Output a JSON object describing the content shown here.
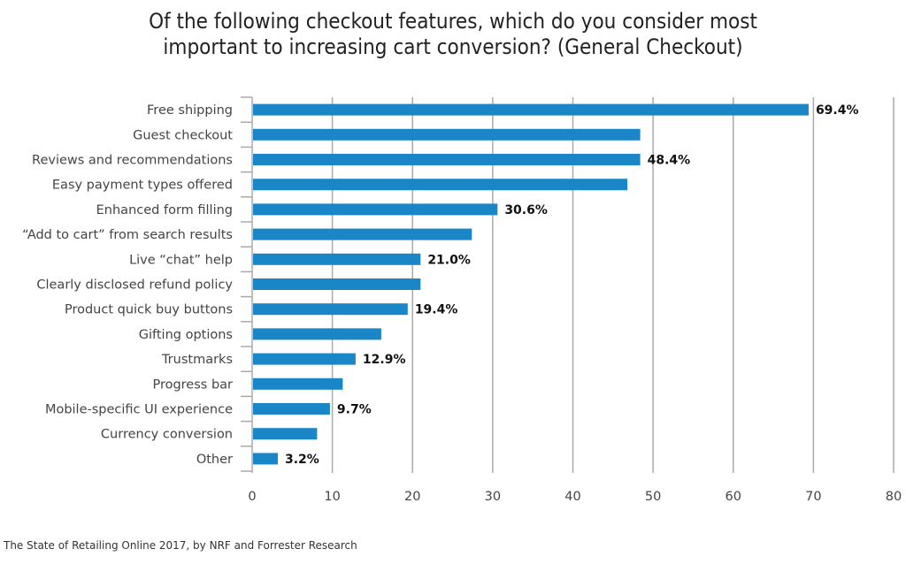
{
  "chart_data": {
    "type": "bar",
    "orientation": "horizontal",
    "title": "Of the following checkout features, which do you consider most important to increasing cart conversion? (General Checkout)",
    "title_lines": [
      "Of the following checkout features, which do you consider most",
      "important to increasing cart conversion? (General Checkout)"
    ],
    "xlabel": "",
    "ylabel": "",
    "xlim": [
      0,
      80
    ],
    "xticks": [
      0,
      10,
      20,
      30,
      40,
      50,
      60,
      70,
      80
    ],
    "grid": true,
    "bar_color": "#1a86c8",
    "categories": [
      "Free shipping",
      "Guest checkout",
      "Reviews and recommendations",
      "Easy payment types offered",
      "Enhanced form filling",
      "“Add to cart” from search results",
      "Live “chat” help",
      "Clearly disclosed refund policy",
      "Product quick buy buttons",
      "Gifting options",
      "Trustmarks",
      "Progress bar",
      "Mobile-specific UI experience",
      "Currency conversion",
      "Other"
    ],
    "values": [
      69.4,
      48.4,
      48.4,
      46.8,
      30.6,
      27.4,
      21.0,
      21.0,
      19.4,
      16.1,
      12.9,
      11.3,
      9.7,
      8.1,
      3.2
    ],
    "data_labels": [
      "69.4%",
      "",
      "48.4%",
      "",
      "30.6%",
      "",
      "21.0%",
      "",
      "19.4%",
      "",
      "12.9%",
      "",
      "9.7%",
      "",
      "3.2%"
    ]
  },
  "source": "The State of Retailing Online 2017, by NRF and Forrester Research"
}
